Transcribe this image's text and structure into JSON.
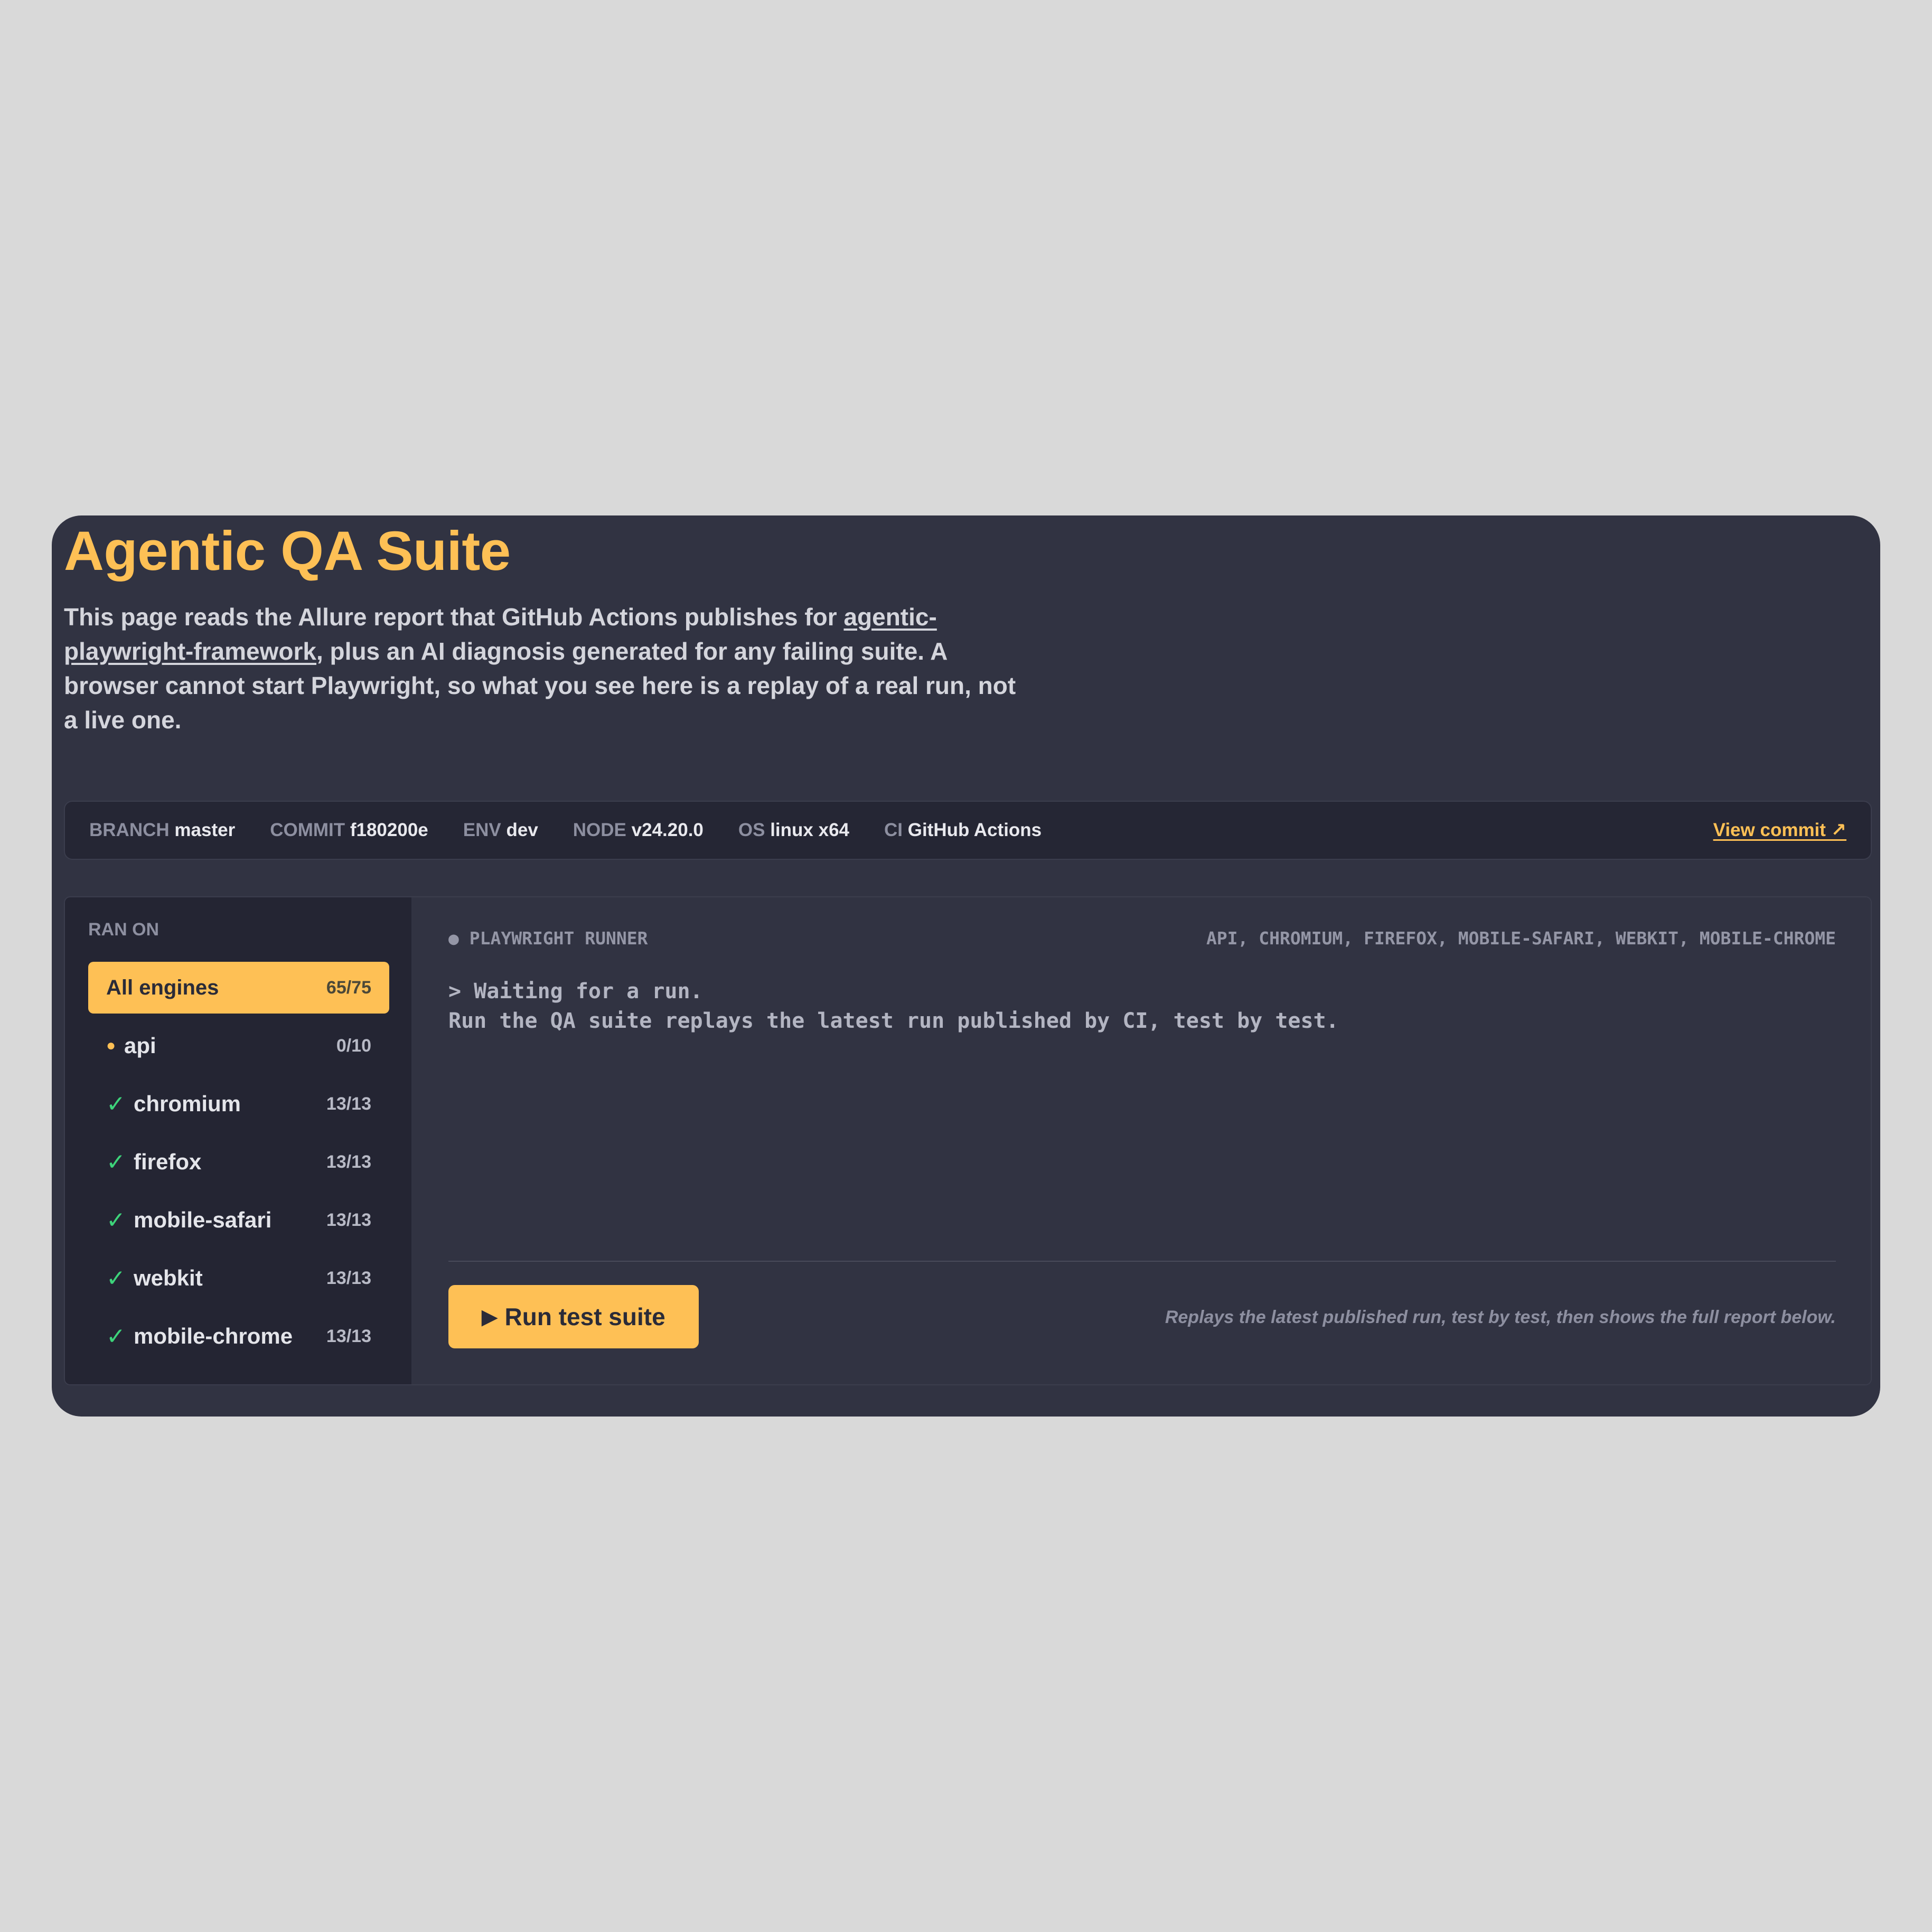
{
  "header": {
    "title": "Agentic QA Suite",
    "intro_before": "This page reads the Allure report that GitHub Actions publishes for ",
    "intro_link": "agentic-playwright-framework",
    "intro_after": ", plus an AI diagnosis generated for any failing suite. A browser cannot start Playwright, so what you see here is a replay of a real run, not a live one."
  },
  "meta": {
    "items": [
      {
        "key": "BRANCH",
        "value": "master"
      },
      {
        "key": "COMMIT",
        "value": "f180200e"
      },
      {
        "key": "ENV",
        "value": "dev"
      },
      {
        "key": "NODE",
        "value": "v24.20.0"
      },
      {
        "key": "OS",
        "value": "linux x64"
      },
      {
        "key": "CI",
        "value": "GitHub Actions"
      }
    ],
    "view_commit": "View commit ↗"
  },
  "sidebar": {
    "heading": "RAN ON",
    "engines": [
      {
        "name": "All engines",
        "count": "65/75",
        "status": "all"
      },
      {
        "name": "api",
        "count": "0/10",
        "status": "pending"
      },
      {
        "name": "chromium",
        "count": "13/13",
        "status": "passed"
      },
      {
        "name": "firefox",
        "count": "13/13",
        "status": "passed"
      },
      {
        "name": "mobile-safari",
        "count": "13/13",
        "status": "passed"
      },
      {
        "name": "webkit",
        "count": "13/13",
        "status": "passed"
      },
      {
        "name": "mobile-chrome",
        "count": "13/13",
        "status": "passed"
      }
    ]
  },
  "runner": {
    "label": "● PLAYWRIGHT RUNNER",
    "engines": "API, CHROMIUM, FIREFOX, MOBILE-SAFARI, WEBKIT, MOBILE-CHROME",
    "log_line1": "> Waiting for a run.",
    "log_line2": "Run the QA suite replays the latest run published by CI, test by test.",
    "button_icon": "▶",
    "button_label": "Run test suite",
    "hint": "Replays the latest published run, test by test, then shows the full report below."
  },
  "colors": {
    "accent": "#fec055",
    "pass": "#3dd37a",
    "card": "#313342",
    "sidebar": "#242533"
  }
}
